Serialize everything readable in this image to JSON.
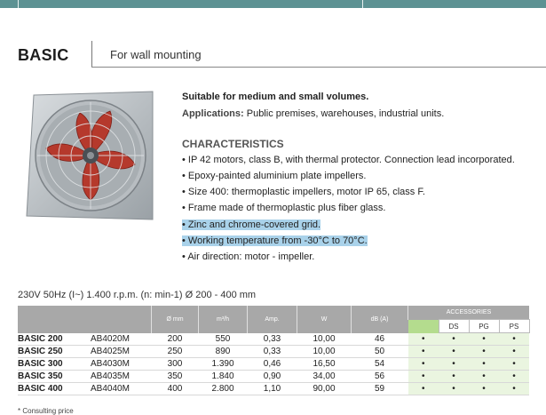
{
  "header": {
    "product": "BASIC",
    "subtitle": "For wall mounting"
  },
  "intro": {
    "suitable": "Suitable for medium and small volumes.",
    "applications_label": "Applications:",
    "applications_text": "Public premises, warehouses, industrial units."
  },
  "characteristics": {
    "heading": "CHARACTERISTICS",
    "items": [
      "IP 42 motors, class B, with thermal protector. Connection lead incorporated.",
      "Epoxy-painted aluminium plate impellers.",
      "Size 400: thermoplastic impellers, motor IP 65, class F.",
      "Frame made of thermoplastic plus fiber glass.",
      "Zinc and chrome-covered grid.",
      "Working temperature from -30°C to 70°C.",
      "Air direction: motor - impeller."
    ]
  },
  "specs_line": "230V 50Hz (I~) 1.400 r.p.m. (n: min-1) Ø 200 - 400 mm",
  "table": {
    "headers": [
      "Ø mm",
      "m³/h",
      "Amp.",
      "W",
      "dB (A)"
    ],
    "accessories_label": "ACCESSORIES",
    "accessory_cols": [
      "DS",
      "PG",
      "PS"
    ],
    "rows": [
      {
        "model": "BASIC 200",
        "code": "AB4020M",
        "d": "200",
        "flow": "550",
        "amp": "0,33",
        "w": "10,00",
        "db": "46",
        "acc": [
          "•",
          "•",
          "•",
          "•"
        ]
      },
      {
        "model": "BASIC 250",
        "code": "AB4025M",
        "d": "250",
        "flow": "890",
        "amp": "0,33",
        "w": "10,00",
        "db": "50",
        "acc": [
          "•",
          "•",
          "•",
          "•"
        ]
      },
      {
        "model": "BASIC 300",
        "code": "AB4030M",
        "d": "300",
        "flow": "1.390",
        "amp": "0,46",
        "w": "16,50",
        "db": "54",
        "acc": [
          "•",
          "•",
          "•",
          "•"
        ]
      },
      {
        "model": "BASIC 350",
        "code": "AB4035M",
        "d": "350",
        "flow": "1.840",
        "amp": "0,90",
        "w": "34,00",
        "db": "56",
        "acc": [
          "•",
          "•",
          "•",
          "•"
        ]
      },
      {
        "model": "BASIC 400",
        "code": "AB4040M",
        "d": "400",
        "flow": "2.800",
        "amp": "1,10",
        "w": "90,00",
        "db": "59",
        "acc": [
          "•",
          "•",
          "•",
          "•"
        ]
      }
    ]
  },
  "footnote": "* Consulting price",
  "colors": {
    "topbar": "#5d9293",
    "table_header": "#a8a8a8",
    "highlight": "#a9d2ea",
    "accessory_green": "#b4dc8e"
  }
}
